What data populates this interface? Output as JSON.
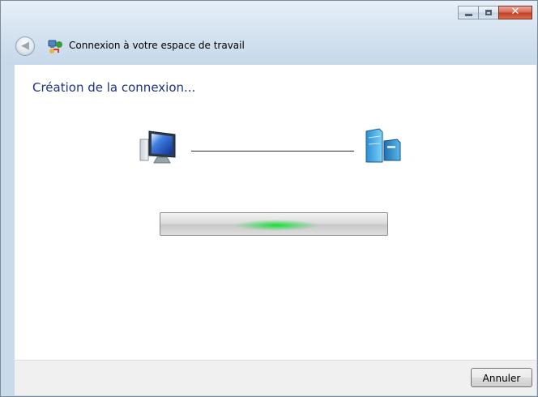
{
  "window": {
    "title": "Connexion à votre espace de travail",
    "controls": {
      "minimize": "minimize-icon",
      "maximize": "maximize-icon",
      "close_label": "✕"
    }
  },
  "nav": {
    "back_icon": "back-arrow-icon",
    "back_glyph": "◀"
  },
  "main": {
    "heading": "Création de la connexion...",
    "left_icon": "computer-icon",
    "right_icon": "network-server-icon",
    "progress": {
      "state": "indeterminate",
      "accent_color": "#22dd44"
    }
  },
  "footer": {
    "cancel_label": "Annuler"
  },
  "colors": {
    "heading": "#1e3287",
    "title_bar": "#d6e4f1",
    "close_button": "#c03e24"
  }
}
